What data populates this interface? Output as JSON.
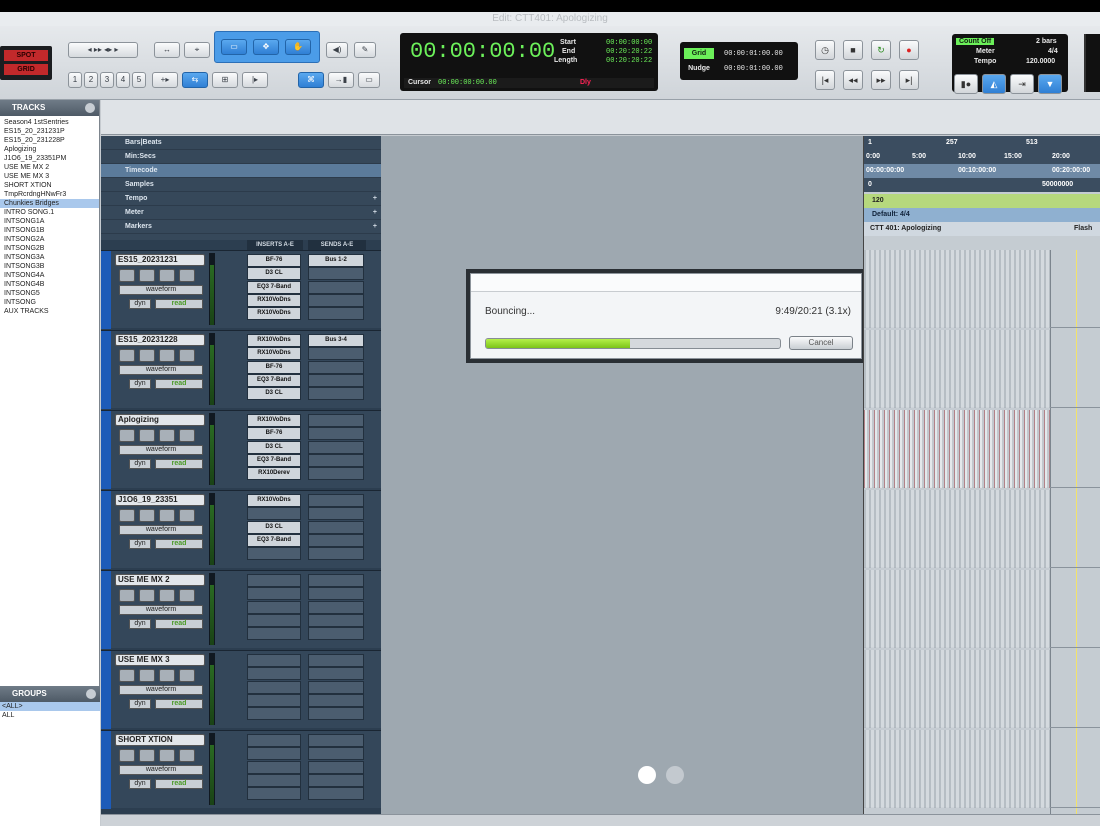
{
  "window": {
    "title": "Edit: CTT401: Apologizing"
  },
  "modes": {
    "spot": "SPOT",
    "grid": "GRID"
  },
  "toolbar": {
    "zoom_presets": [
      "1",
      "2",
      "3",
      "4",
      "5"
    ]
  },
  "counter": {
    "main": "00:00:00:00",
    "start_label": "Start",
    "end_label": "End",
    "length_label": "Length",
    "start": "00:00:00:00",
    "end": "00:20:20:22",
    "length": "00:20:20:22",
    "cursor_label": "Cursor",
    "cursor": "00:00:00:00.00",
    "dly": "Dly"
  },
  "grid": {
    "grid_label": "Grid",
    "grid_value": "00:00:01:00.00",
    "nudge_label": "Nudge",
    "nudge_value": "00:00:01:00.00"
  },
  "countoff": {
    "label": "Count Off",
    "bars": "2 bars",
    "meter_label": "Meter",
    "meter": "4/4",
    "tempo_label": "Tempo",
    "tempo": "120.0000"
  },
  "tracks_panel": {
    "title": "TRACKS",
    "items": [
      "Season4 1stSentries",
      "ES15_20_231231P",
      "ES15_20_231228P",
      "Aplogizing",
      "J1O6_19_23351PM",
      "USE ME MX 2",
      "USE ME MX 3",
      "SHORT XTION",
      "TmpRcrdngHNwFr3",
      "Chunkies Bridges",
      "INTRO SONG.1",
      "INTSONG1A",
      "INTSONG1B",
      "INTSONG2A",
      "INTSONG2B",
      "INTSONG3A",
      "INTSONG3B",
      "INTSONG4A",
      "INTSONG4B",
      "INTSONG5",
      "INTSONG",
      "AUX TRACKS"
    ],
    "selected_index": 9
  },
  "groups_panel": {
    "title": "GROUPS",
    "items": [
      "<ALL>",
      "ALL"
    ]
  },
  "rulers": [
    {
      "label": "Bars|Beats",
      "plus": ""
    },
    {
      "label": "Min:Secs",
      "plus": ""
    },
    {
      "label": "Timecode",
      "plus": ""
    },
    {
      "label": "Samples",
      "plus": ""
    },
    {
      "label": "Tempo",
      "plus": "+"
    },
    {
      "label": "Meter",
      "plus": "+"
    },
    {
      "label": "Markers",
      "plus": "+"
    }
  ],
  "columns": {
    "inserts": "INSERTS A-E",
    "sends": "SENDS A-E"
  },
  "edit_tracks": [
    {
      "name": "ES15_20231231",
      "view": "waveform",
      "dyn": "dyn",
      "auto": "read",
      "inserts": [
        "BF-76",
        "D3 CL",
        "EQ3 7-Band",
        "RX10VoDns",
        "RX10VoDns"
      ],
      "sends": [
        "Bus 1-2",
        "",
        "",
        "",
        ""
      ]
    },
    {
      "name": "ES15_20231228",
      "view": "waveform",
      "dyn": "dyn",
      "auto": "read",
      "inserts": [
        "RX10VoDns",
        "RX10VoDns",
        "BF-76",
        "EQ3 7-Band",
        "D3 CL"
      ],
      "sends": [
        "Bus 3-4",
        "",
        "",
        "",
        ""
      ]
    },
    {
      "name": "Aplogizing",
      "view": "waveform",
      "dyn": "dyn",
      "auto": "read",
      "inserts": [
        "RX10VoDns",
        "BF-76",
        "D3 CL",
        "EQ3 7-Band",
        "RX10Derev"
      ],
      "sends": [
        "",
        "",
        "",
        "",
        ""
      ]
    },
    {
      "name": "J1O6_19_23351",
      "view": "waveform",
      "dyn": "dyn",
      "auto": "read",
      "inserts": [
        "RX10VoDns",
        "",
        "D3 CL",
        "EQ3 7-Band",
        ""
      ],
      "sends": [
        "",
        "",
        "",
        "",
        ""
      ]
    },
    {
      "name": "USE ME MX 2",
      "view": "waveform",
      "dyn": "dyn",
      "auto": "read",
      "inserts": [
        "",
        "",
        "",
        "",
        ""
      ],
      "sends": [
        "",
        "",
        "",
        "",
        ""
      ]
    },
    {
      "name": "USE ME MX 3",
      "view": "waveform",
      "dyn": "dyn",
      "auto": "read",
      "inserts": [
        "",
        "",
        "",
        "",
        ""
      ],
      "sends": [
        "",
        "",
        "",
        "",
        ""
      ]
    },
    {
      "name": "SHORT XTION",
      "view": "waveform",
      "dyn": "dyn",
      "auto": "read",
      "inserts": [
        "",
        "",
        "",
        "",
        ""
      ],
      "sends": [
        "",
        "",
        "",
        "",
        ""
      ]
    }
  ],
  "bounce_dialog": {
    "message": "Bouncing...",
    "time": "9:49/20:21 (3.1x)",
    "progress_fraction": 0.49,
    "cancel_label": "Cancel"
  },
  "timeline": {
    "bars_ticks": [
      "1",
      "257",
      "513"
    ],
    "minsec_ticks": [
      "0:00",
      "5:00",
      "10:00",
      "15:00",
      "20:00"
    ],
    "timecode_ticks": [
      "00:00:00:00",
      "00:10:00:00",
      "00:20:00:00"
    ],
    "samples_ticks": [
      "0",
      "50000000"
    ],
    "tempo": "120",
    "meter": "Default: 4/4",
    "marker": "CTT 401: Apologizing",
    "marker2": "Flash"
  },
  "colors": {
    "accent": "#4b9ce8",
    "counter_green": "#6cf05a",
    "progress": "#8fd226",
    "track_strip": "#1d5bb8"
  }
}
